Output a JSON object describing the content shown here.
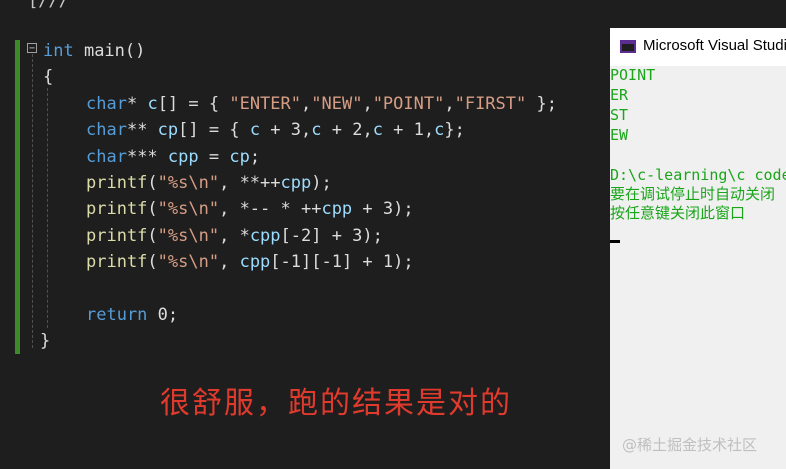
{
  "editor": {
    "top_fragment": "[///",
    "code": {
      "sig_kw": "int",
      "sig_name": " main()",
      "open_brace": "{",
      "l1": [
        "char",
        "* ",
        "c",
        "[] = { ",
        "\"ENTER\"",
        ",",
        "\"NEW\"",
        ",",
        "\"POINT\"",
        ",",
        "\"FIRST\"",
        " };"
      ],
      "l2": [
        "char",
        "** ",
        "cp",
        "[] = { ",
        "c",
        " + 3,",
        "c",
        " + 2,",
        "c",
        " + 1,",
        "c",
        "};"
      ],
      "l3": [
        "char",
        "*** ",
        "cpp",
        " = ",
        "cp",
        ";"
      ],
      "l4": [
        "printf",
        "(",
        "\"%s\\n\"",
        ", **++",
        "cpp",
        ");"
      ],
      "l5": [
        "printf",
        "(",
        "\"%s\\n\"",
        ", *-- * ++",
        "cpp",
        " + 3);"
      ],
      "l6": [
        "printf",
        "(",
        "\"%s\\n\"",
        ", *",
        "cpp",
        "[-2] + 3);"
      ],
      "l7": [
        "printf",
        "(",
        "\"%s\\n\"",
        ", ",
        "cpp",
        "[-1][-1] + 1);"
      ],
      "ret_kw": "return",
      "ret_val": " 0;",
      "close_brace": "}"
    },
    "fold_symbol": "−"
  },
  "caption": "很舒服，跑的结果是对的",
  "console": {
    "title": "Microsoft Visual Studio",
    "output": [
      "POINT",
      "ER",
      "ST",
      "EW",
      "",
      "D:\\c-learning\\c code",
      "要在调试停止时自动关闭",
      "按任意键关闭此窗口"
    ]
  },
  "watermark": "@稀土掘金技术社区",
  "colors": {
    "keyword": "#569cd6",
    "string": "#d69d85",
    "console_text": "#1aa51a",
    "caption": "#e03a2d"
  }
}
